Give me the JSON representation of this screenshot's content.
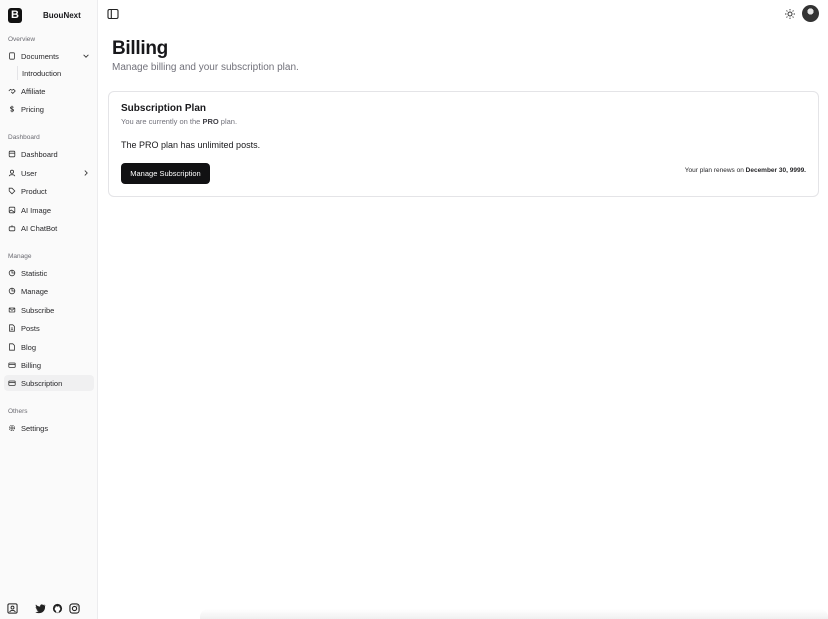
{
  "brand": {
    "logo_letter": "B",
    "name": "BuouNext"
  },
  "sidebar": {
    "groups": [
      {
        "label": "Overview",
        "items": [
          {
            "label": "Documents",
            "icon": "document-icon",
            "chevron": "down"
          },
          {
            "label": "Introduction",
            "sub": true
          },
          {
            "label": "Affiliate",
            "icon": "handshake-icon"
          },
          {
            "label": "Pricing",
            "icon": "dollar-icon"
          }
        ]
      },
      {
        "label": "Dashboard",
        "items": [
          {
            "label": "Dashboard",
            "icon": "dashboard-icon"
          },
          {
            "label": "User",
            "icon": "user-icon",
            "chevron": "right"
          },
          {
            "label": "Product",
            "icon": "tag-icon"
          },
          {
            "label": "AI Image",
            "icon": "image-icon"
          },
          {
            "label": "AI ChatBot",
            "icon": "bot-icon"
          }
        ]
      },
      {
        "label": "Manage",
        "items": [
          {
            "label": "Statistic",
            "icon": "pie-chart-icon"
          },
          {
            "label": "Manage",
            "icon": "pie-chart-icon"
          },
          {
            "label": "Subscribe",
            "icon": "mail-icon"
          },
          {
            "label": "Posts",
            "icon": "file-text-icon"
          },
          {
            "label": "Blog",
            "icon": "file-icon"
          },
          {
            "label": "Billing",
            "icon": "credit-card-icon"
          },
          {
            "label": "Subscription",
            "icon": "credit-card-icon",
            "active": true
          }
        ]
      },
      {
        "label": "Others",
        "items": [
          {
            "label": "Settings",
            "icon": "gear-icon"
          }
        ]
      }
    ],
    "footer_icons": [
      "contact-icon",
      "twitter-icon",
      "github-icon",
      "instagram-icon"
    ]
  },
  "header": {
    "toggle_icon": "sidebar-toggle-icon",
    "theme_icon": "sun-icon",
    "avatar": "user-avatar"
  },
  "page": {
    "title": "Billing",
    "subtitle": "Manage billing and your subscription plan."
  },
  "plan_card": {
    "title": "Subscription Plan",
    "desc_prefix": "You are currently on the ",
    "plan_name": "PRO",
    "desc_suffix": " plan.",
    "info": "The PRO plan has unlimited posts.",
    "button_label": "Manage Subscription",
    "renew_prefix": "Your plan renews on ",
    "renew_date": "December 30, 9999."
  }
}
